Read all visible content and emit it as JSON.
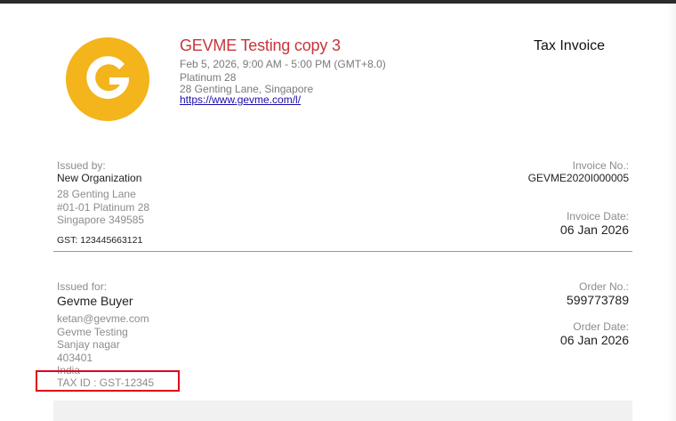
{
  "event": {
    "title": "GEVME Testing copy 3",
    "datetime": "Feb 5, 2026, 9:00 AM - 5:00 PM (GMT+8.0)",
    "venue": "Platinum 28",
    "address": "28 Genting Lane, Singapore",
    "url": "https://www.gevme.com/l/"
  },
  "logo": {
    "letter": "G",
    "color": "#f3b41c",
    "icon": "gevme-logo-icon"
  },
  "document_title": "Tax Invoice",
  "issuer": {
    "label": "Issued by:",
    "name": "New Organization",
    "address_lines": [
      "28 Genting Lane",
      "#01-01 Platinum 28",
      "Singapore 349585"
    ],
    "gst": "GST: 123445663121"
  },
  "invoice": {
    "number_label": "Invoice No.:",
    "number": "GEVME2020I000005",
    "date_label": "Invoice Date:",
    "date": "06 Jan 2026"
  },
  "buyer": {
    "label": "Issued for:",
    "name": "Gevme Buyer",
    "details": [
      "ketan@gevme.com",
      "Gevme Testing",
      "Sanjay nagar",
      "403401",
      "India"
    ],
    "tax_id": "TAX ID : GST-12345"
  },
  "order": {
    "number_label": "Order No.:",
    "number": "599773789",
    "date_label": "Order Date:",
    "date": "06 Jan 2026"
  },
  "colors": {
    "title_red": "#c6353a",
    "highlight_red": "#e0001b",
    "link_blue": "#1a0dab"
  }
}
